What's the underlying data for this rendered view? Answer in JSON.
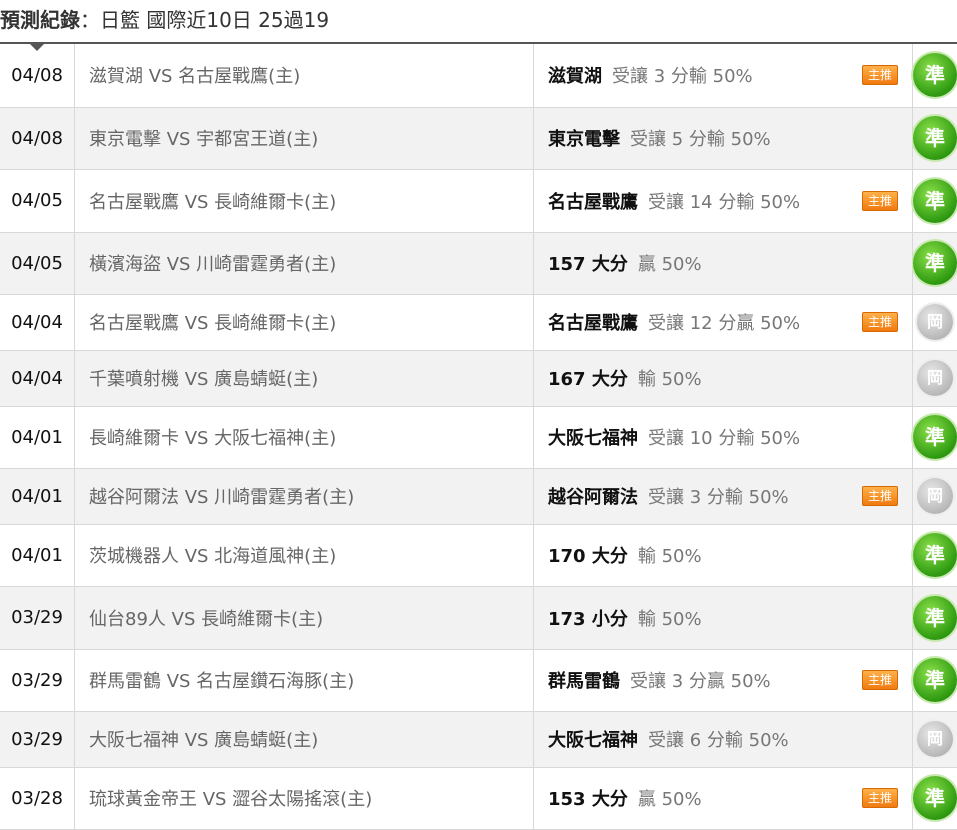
{
  "header": {
    "label": "預測紀錄",
    "colon": "：",
    "summary": "日籃 國際近10日 25過19"
  },
  "rows": [
    {
      "date": "04/08",
      "match": "滋賀湖 VS 名古屋戰鷹(主)",
      "pick": "滋賀湖",
      "detail": "受讓 3 分輸 50%",
      "badge": "主推",
      "result": "準",
      "result_type": "win",
      "alt": false,
      "h": 63
    },
    {
      "date": "04/08",
      "match": "東京電擊 VS 宇都宮王道(主)",
      "pick": "東京電擊",
      "detail": "受讓 5 分輸 50%",
      "badge": "",
      "result": "準",
      "result_type": "win",
      "alt": true,
      "h": 62
    },
    {
      "date": "04/05",
      "match": "名古屋戰鷹 VS 長崎維爾卡(主)",
      "pick": "名古屋戰鷹",
      "detail": "受讓 14 分輸 50%",
      "badge": "主推",
      "result": "準",
      "result_type": "win",
      "alt": false,
      "h": 63
    },
    {
      "date": "04/05",
      "match": "橫濱海盜 VS 川崎雷霆勇者(主)",
      "pick": "157 大分",
      "detail": "贏 50%",
      "badge": "",
      "result": "準",
      "result_type": "win",
      "alt": true,
      "h": 62
    },
    {
      "date": "04/04",
      "match": "名古屋戰鷹 VS 長崎維爾卡(主)",
      "pick": "名古屋戰鷹",
      "detail": "受讓 12 分贏 50%",
      "badge": "主推",
      "result": "岡",
      "result_type": "push",
      "alt": false,
      "h": 56
    },
    {
      "date": "04/04",
      "match": "千葉噴射機 VS 廣島蜻蜓(主)",
      "pick": "167 大分",
      "detail": "輸 50%",
      "badge": "",
      "result": "岡",
      "result_type": "push",
      "alt": true,
      "h": 56
    },
    {
      "date": "04/01",
      "match": "長崎維爾卡 VS 大阪七福神(主)",
      "pick": "大阪七福神",
      "detail": "受讓 10 分輸 50%",
      "badge": "",
      "result": "準",
      "result_type": "win",
      "alt": false,
      "h": 62
    },
    {
      "date": "04/01",
      "match": "越谷阿爾法 VS 川崎雷霆勇者(主)",
      "pick": "越谷阿爾法",
      "detail": "受讓 3 分輸 50%",
      "badge": "主推",
      "result": "岡",
      "result_type": "push",
      "alt": true,
      "h": 56
    },
    {
      "date": "04/01",
      "match": "茨城機器人 VS 北海道風神(主)",
      "pick": "170 大分",
      "detail": "輸 50%",
      "badge": "",
      "result": "準",
      "result_type": "win",
      "alt": false,
      "h": 62
    },
    {
      "date": "03/29",
      "match": "仙台89人 VS 長崎維爾卡(主)",
      "pick": "173 小分",
      "detail": "輸 50%",
      "badge": "",
      "result": "準",
      "result_type": "win",
      "alt": true,
      "h": 63
    },
    {
      "date": "03/29",
      "match": "群馬雷鶴 VS 名古屋鑽石海豚(主)",
      "pick": "群馬雷鶴",
      "detail": "受讓 3 分贏 50%",
      "badge": "主推",
      "result": "準",
      "result_type": "win",
      "alt": false,
      "h": 62
    },
    {
      "date": "03/29",
      "match": "大阪七福神 VS 廣島蜻蜓(主)",
      "pick": "大阪七福神",
      "detail": "受讓 6 分輸 50%",
      "badge": "",
      "result": "岡",
      "result_type": "push",
      "alt": true,
      "h": 56
    },
    {
      "date": "03/28",
      "match": "琉球黃金帝王 VS 澀谷太陽搖滾(主)",
      "pick": "153 大分",
      "detail": "贏 50%",
      "badge": "主推",
      "result": "準",
      "result_type": "win",
      "alt": false,
      "h": 62
    }
  ]
}
